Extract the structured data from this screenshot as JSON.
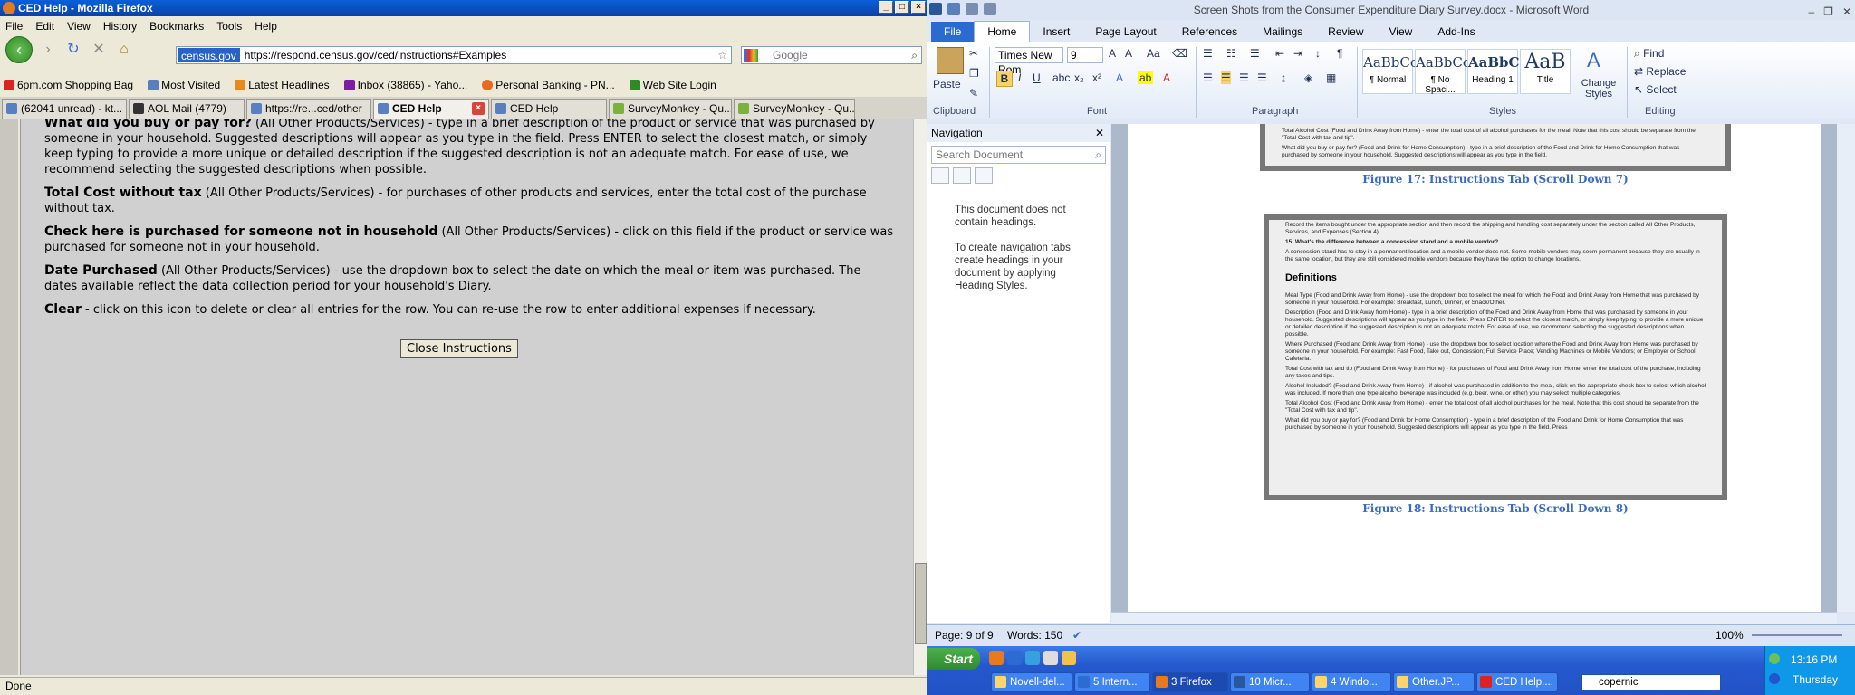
{
  "firefox": {
    "title": "CED Help - Mozilla Firefox",
    "menu": [
      "File",
      "Edit",
      "View",
      "History",
      "Bookmarks",
      "Tools",
      "Help"
    ],
    "site_identity": "census.gov",
    "url": "https://respond.census.gov/ced/instructions#Examples",
    "search_placeholder": "Google",
    "bookmarks": [
      "6pm.com Shopping Bag",
      "Most Visited",
      "Latest Headlines",
      "Inbox (38865) - Yaho...",
      "Personal Banking - PN...",
      "Web Site Login"
    ],
    "tabs": [
      "(62041 unread) - kt...",
      "AOL Mail (4779)",
      "https://re...ced/other",
      "CED Help",
      "CED Help",
      "SurveyMonkey - Qu...",
      "SurveyMonkey - Qu..."
    ],
    "content": [
      {
        "term": "What did you buy or pay for?",
        "text": " (All Other Products/Services) - type in a brief description of the product or service that was purchased by someone in your household. Suggested descriptions will appear as you type in the field. Press ENTER to select the closest match, or simply keep typing to provide a more unique or detailed description if the suggested description is not an adequate match. For ease of use, we recommend selecting the suggested descriptions when possible."
      },
      {
        "term": "Total Cost without tax",
        "text": " (All Other Products/Services) - for purchases of other products and services, enter the total cost of the purchase without tax."
      },
      {
        "term": "Check here is purchased for someone not in household",
        "text": " (All Other Products/Services) - click on this field if the product or service was purchased for someone not in your household."
      },
      {
        "term": "Date Purchased",
        "text": " (All Other Products/Services) - use the dropdown box to select the date on which the meal or item was purchased. The dates available reflect the data collection period for your household's Diary."
      },
      {
        "term": "Clear",
        "text": " - click on this icon to delete or clear all entries for the row. You can re-use the row to enter additional expenses if necessary."
      }
    ],
    "close_button": "Close Instructions",
    "status": "Done"
  },
  "word": {
    "title": "Screen Shots from the Consumer Expenditure Diary Survey.docx  -  Microsoft Word",
    "ribbon_tabs": [
      "File",
      "Home",
      "Insert",
      "Page Layout",
      "References",
      "Mailings",
      "Review",
      "View",
      "Add-Ins"
    ],
    "font_name": "Times New Rom",
    "font_size": "9",
    "groups": [
      "Clipboard",
      "Font",
      "Paragraph",
      "Styles",
      "Editing"
    ],
    "paste": "Paste",
    "styles": [
      {
        "sample": "AaBbCcI",
        "label": "¶ Normal"
      },
      {
        "sample": "AaBbCcI",
        "label": "¶ No Spaci..."
      },
      {
        "sample": "AaBbC",
        "label": "Heading 1"
      },
      {
        "sample": "AaB",
        "label": "Title"
      }
    ],
    "change_styles": "Change Styles",
    "editing": [
      "Find",
      "Replace",
      "Select"
    ],
    "nav": {
      "title": "Navigation",
      "search": "Search Document",
      "msg1": "This document does not contain headings.",
      "msg2": "To create navigation tabs, create headings in your document by applying Heading Styles."
    },
    "shot1_lines": [
      "Total Alcohol Cost (Food and Drink Away from Home) - enter the total cost of all alcohol purchases for the meal. Note that this cost should be separate from the \"Total Cost with tax and tip\".",
      "What did you buy or pay for? (Food and Drink for Home Consumption) - type in a brief description of the Food and Drink for Home Consumption that was purchased by someone in your household. Suggested descriptions will appear as you type in the field."
    ],
    "caption1": "Figure 17: Instructions Tab (Scroll Down 7)",
    "shot2_lines": [
      "Record the items bought under the appropriate section and then record the shipping and handling cost separately under the section called All Other Products, Services, and Expenses (Section 4).",
      "15. What's the difference between a concession stand and a mobile vendor?",
      "A concession stand has to stay in a permanent location and a mobile vendor does not. Some mobile vendors may seem permanent because they are usually in the same location, but they are still considered mobile vendors because they have the option to change locations."
    ],
    "shot2_heading": "Definitions",
    "shot2_defs": [
      "Meal Type (Food and Drink Away from Home) - use the dropdown box to select the meal for which the Food and Drink Away from Home that was purchased by someone in your household. For example: Breakfast, Lunch, Dinner, or Snack/Other.",
      "Description (Food and Drink Away from Home) - type in a brief description of the Food and Drink Away from Home that was purchased by someone in your household. Suggested descriptions will appear as you type in the field. Press ENTER to select the closest match, or simply keep typing to provide a more unique or detailed description if the suggested description is not an adequate match. For ease of use, we recommend selecting the suggested descriptions when possible.",
      "Where Purchased (Food and Drink Away from Home) - use the dropdown box to select location where the Food and Drink Away from Home was purchased by someone in your household. For example: Fast Food, Take out, Concession; Full Service Place; Vending Machines or Mobile Vendors; or Employer or School Cafeteria.",
      "Total Cost with tax and tip (Food and Drink Away from Home) - for purchases of Food and Drink Away from Home, enter the total cost of the purchase, including any taxes and tips.",
      "Alcohol Included? (Food and Drink Away from Home) - if alcohol was purchased in addition to the meal, click on the appropriate check box to select which alcohol was included. If more than one type alcohol beverage was included (e.g. beer, wine, or other) you may select multiple categories.",
      "Total Alcohol Cost (Food and Drink Away from Home) - enter the total cost of all alcohol purchases for the meal. Note that this cost should be separate from the \"Total Cost with tax and tip\".",
      "What did you buy or pay for? (Food and Drink for Home Consumption) - type in a brief description of the Food and Drink for Home Consumption that was purchased by someone in your household. Suggested descriptions will appear as you type in the field. Press"
    ],
    "caption2": "Figure 18: Instructions Tab (Scroll Down 8)",
    "status_page": "Page: 9 of 9",
    "status_words": "Words: 150",
    "zoom": "100%"
  },
  "taskbar": {
    "start": "Start",
    "buttons": [
      "Novell-del...",
      "5 Intern...",
      "3 Firefox",
      "10 Micr...",
      "4 Windo...",
      "Other.JP...",
      "CED Help...."
    ],
    "search": "copernic",
    "time": "13:16 PM",
    "day": "Thursday"
  }
}
